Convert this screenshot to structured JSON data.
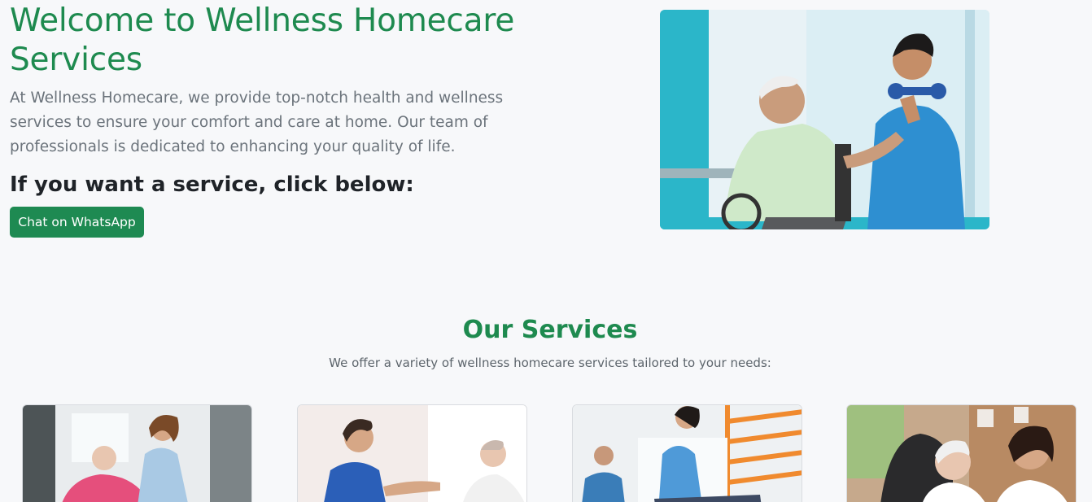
{
  "hero": {
    "title": "Welcome to Wellness Homecare Services",
    "description": "At Wellness Homecare, we provide top-notch health and wellness services to ensure your comfort and care at home. Our team of professionals is dedicated to enhancing your quality of life.",
    "subheading": "If you want a service, click below:",
    "whatsapp_button": "Chat on WhatsApp"
  },
  "services": {
    "title": "Our Services",
    "description": "We offer a variety of wellness homecare services tailored to your needs:"
  },
  "colors": {
    "brand_green": "#1e8a4f",
    "button_green": "#1e8a52",
    "background": "#f7f8fa"
  }
}
